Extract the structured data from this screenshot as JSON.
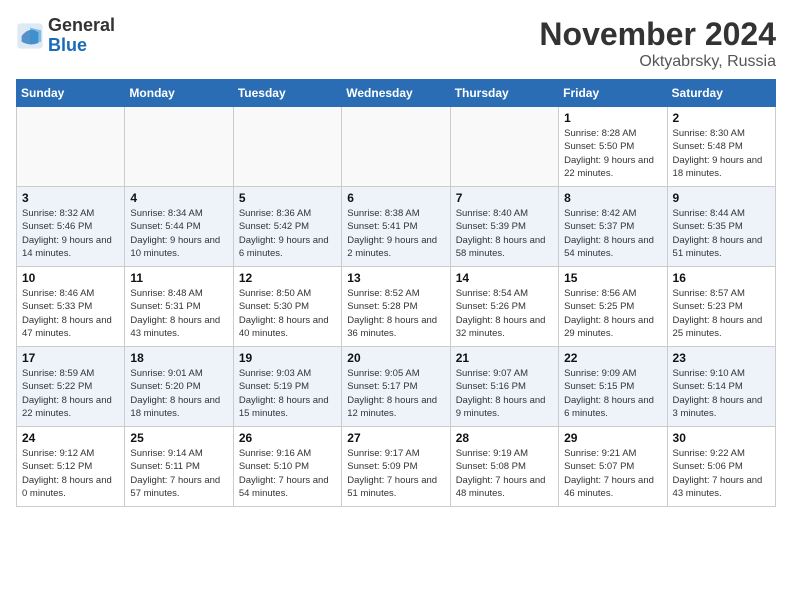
{
  "header": {
    "logo_general": "General",
    "logo_blue": "Blue",
    "month_title": "November 2024",
    "location": "Oktyabrsky, Russia"
  },
  "weekdays": [
    "Sunday",
    "Monday",
    "Tuesday",
    "Wednesday",
    "Thursday",
    "Friday",
    "Saturday"
  ],
  "weeks": [
    [
      {
        "day": "",
        "empty": true
      },
      {
        "day": "",
        "empty": true
      },
      {
        "day": "",
        "empty": true
      },
      {
        "day": "",
        "empty": true
      },
      {
        "day": "",
        "empty": true
      },
      {
        "day": "1",
        "sunrise": "8:28 AM",
        "sunset": "5:50 PM",
        "daylight": "9 hours and 22 minutes."
      },
      {
        "day": "2",
        "sunrise": "8:30 AM",
        "sunset": "5:48 PM",
        "daylight": "9 hours and 18 minutes."
      }
    ],
    [
      {
        "day": "3",
        "sunrise": "8:32 AM",
        "sunset": "5:46 PM",
        "daylight": "9 hours and 14 minutes."
      },
      {
        "day": "4",
        "sunrise": "8:34 AM",
        "sunset": "5:44 PM",
        "daylight": "9 hours and 10 minutes."
      },
      {
        "day": "5",
        "sunrise": "8:36 AM",
        "sunset": "5:42 PM",
        "daylight": "9 hours and 6 minutes."
      },
      {
        "day": "6",
        "sunrise": "8:38 AM",
        "sunset": "5:41 PM",
        "daylight": "9 hours and 2 minutes."
      },
      {
        "day": "7",
        "sunrise": "8:40 AM",
        "sunset": "5:39 PM",
        "daylight": "8 hours and 58 minutes."
      },
      {
        "day": "8",
        "sunrise": "8:42 AM",
        "sunset": "5:37 PM",
        "daylight": "8 hours and 54 minutes."
      },
      {
        "day": "9",
        "sunrise": "8:44 AM",
        "sunset": "5:35 PM",
        "daylight": "8 hours and 51 minutes."
      }
    ],
    [
      {
        "day": "10",
        "sunrise": "8:46 AM",
        "sunset": "5:33 PM",
        "daylight": "8 hours and 47 minutes."
      },
      {
        "day": "11",
        "sunrise": "8:48 AM",
        "sunset": "5:31 PM",
        "daylight": "8 hours and 43 minutes."
      },
      {
        "day": "12",
        "sunrise": "8:50 AM",
        "sunset": "5:30 PM",
        "daylight": "8 hours and 40 minutes."
      },
      {
        "day": "13",
        "sunrise": "8:52 AM",
        "sunset": "5:28 PM",
        "daylight": "8 hours and 36 minutes."
      },
      {
        "day": "14",
        "sunrise": "8:54 AM",
        "sunset": "5:26 PM",
        "daylight": "8 hours and 32 minutes."
      },
      {
        "day": "15",
        "sunrise": "8:56 AM",
        "sunset": "5:25 PM",
        "daylight": "8 hours and 29 minutes."
      },
      {
        "day": "16",
        "sunrise": "8:57 AM",
        "sunset": "5:23 PM",
        "daylight": "8 hours and 25 minutes."
      }
    ],
    [
      {
        "day": "17",
        "sunrise": "8:59 AM",
        "sunset": "5:22 PM",
        "daylight": "8 hours and 22 minutes."
      },
      {
        "day": "18",
        "sunrise": "9:01 AM",
        "sunset": "5:20 PM",
        "daylight": "8 hours and 18 minutes."
      },
      {
        "day": "19",
        "sunrise": "9:03 AM",
        "sunset": "5:19 PM",
        "daylight": "8 hours and 15 minutes."
      },
      {
        "day": "20",
        "sunrise": "9:05 AM",
        "sunset": "5:17 PM",
        "daylight": "8 hours and 12 minutes."
      },
      {
        "day": "21",
        "sunrise": "9:07 AM",
        "sunset": "5:16 PM",
        "daylight": "8 hours and 9 minutes."
      },
      {
        "day": "22",
        "sunrise": "9:09 AM",
        "sunset": "5:15 PM",
        "daylight": "8 hours and 6 minutes."
      },
      {
        "day": "23",
        "sunrise": "9:10 AM",
        "sunset": "5:14 PM",
        "daylight": "8 hours and 3 minutes."
      }
    ],
    [
      {
        "day": "24",
        "sunrise": "9:12 AM",
        "sunset": "5:12 PM",
        "daylight": "8 hours and 0 minutes."
      },
      {
        "day": "25",
        "sunrise": "9:14 AM",
        "sunset": "5:11 PM",
        "daylight": "7 hours and 57 minutes."
      },
      {
        "day": "26",
        "sunrise": "9:16 AM",
        "sunset": "5:10 PM",
        "daylight": "7 hours and 54 minutes."
      },
      {
        "day": "27",
        "sunrise": "9:17 AM",
        "sunset": "5:09 PM",
        "daylight": "7 hours and 51 minutes."
      },
      {
        "day": "28",
        "sunrise": "9:19 AM",
        "sunset": "5:08 PM",
        "daylight": "7 hours and 48 minutes."
      },
      {
        "day": "29",
        "sunrise": "9:21 AM",
        "sunset": "5:07 PM",
        "daylight": "7 hours and 46 minutes."
      },
      {
        "day": "30",
        "sunrise": "9:22 AM",
        "sunset": "5:06 PM",
        "daylight": "7 hours and 43 minutes."
      }
    ]
  ]
}
